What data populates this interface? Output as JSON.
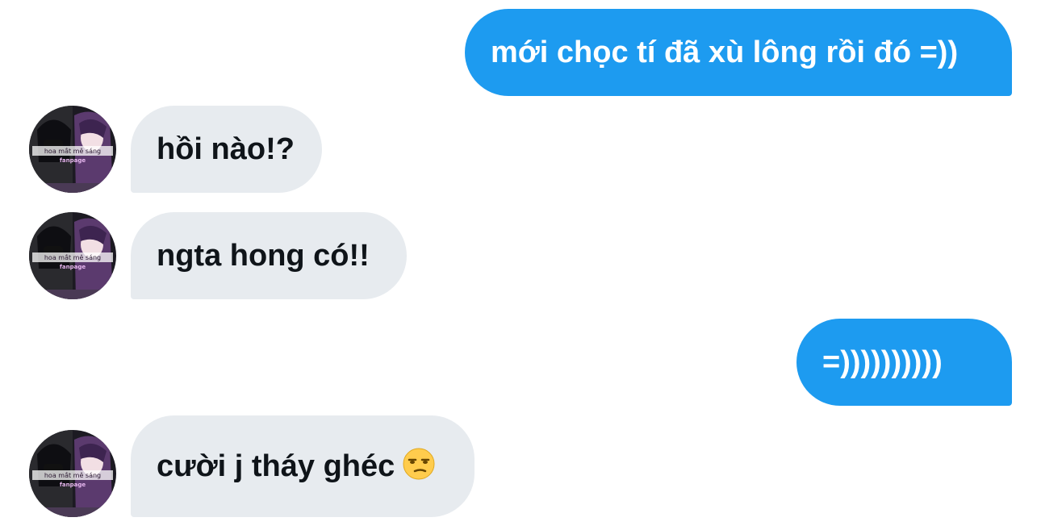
{
  "messages": [
    {
      "from": "me",
      "text": "mới chọc tí đã xù lông rồi đó =))"
    },
    {
      "from": "them",
      "text": "hồi nào!?"
    },
    {
      "from": "them",
      "text": "ngta hong có!!"
    },
    {
      "from": "me",
      "text": "=))))))))))"
    },
    {
      "from": "them",
      "text": "cười j tháy ghéc",
      "emoji": "unamused-face"
    }
  ],
  "avatar": {
    "icon": "profile-avatar-anime-art",
    "caption_line1": "hoa mắt mê sáng",
    "caption_line2": "fanpage"
  },
  "colors": {
    "sent_bubble": "#1d9bf0",
    "received_bubble": "#e7ebef",
    "sent_text": "#ffffff",
    "received_text": "#0f1419"
  }
}
